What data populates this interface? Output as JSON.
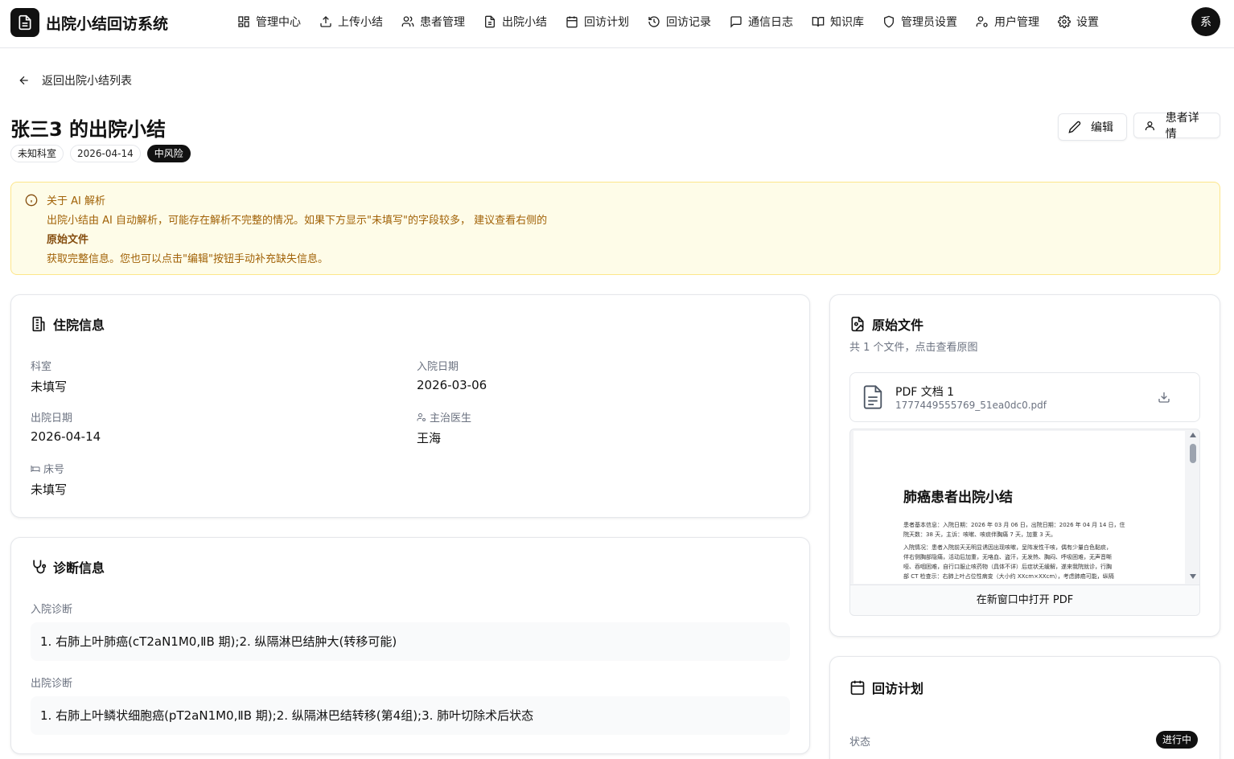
{
  "app": {
    "title": "出院小结回访系统",
    "avatar_text": "系"
  },
  "nav": {
    "items": [
      {
        "label": "管理中心",
        "icon": "dashboard-icon"
      },
      {
        "label": "上传小结",
        "icon": "upload-icon"
      },
      {
        "label": "患者管理",
        "icon": "users-icon"
      },
      {
        "label": "出院小结",
        "icon": "file-icon"
      },
      {
        "label": "回访计划",
        "icon": "calendar-icon"
      },
      {
        "label": "回访记录",
        "icon": "history-icon"
      },
      {
        "label": "通信日志",
        "icon": "message-icon"
      },
      {
        "label": "知识库",
        "icon": "book-icon"
      },
      {
        "label": "管理员设置",
        "icon": "shield-icon"
      },
      {
        "label": "用户管理",
        "icon": "user-cog-icon"
      },
      {
        "label": "设置",
        "icon": "gear-icon"
      }
    ]
  },
  "back_link": "返回出院小结列表",
  "header": {
    "title": "张三3 的出院小结",
    "tags": {
      "department": "未知科室",
      "date": "2026-04-14",
      "risk": "中风险"
    },
    "edit_label": "编辑",
    "patient_detail_label": "患者详情"
  },
  "alert": {
    "title": "关于 AI 解析",
    "line1": "出院小结由 AI 自动解析，可能存在解析不完整的情况。如果下方显示\"未填写\"的字段较多， 建议查看右侧的",
    "emphasis": "原始文件",
    "line2": "获取完整信息。您也可以点击\"编辑\"按钮手动补充缺失信息。"
  },
  "hospital_info": {
    "title": "住院信息",
    "department_label": "科室",
    "department_value": "未填写",
    "admission_label": "入院日期",
    "admission_value": "2026-03-06",
    "discharge_label": "出院日期",
    "discharge_value": "2026-04-14",
    "doctor_label": "主治医生",
    "doctor_value": "王海",
    "bed_label": "床号",
    "bed_value": "未填写"
  },
  "diagnosis": {
    "title": "诊断信息",
    "admission_label": "入院诊断",
    "admission_value": "1. 右肺上叶肺癌(cT2aN1M0,ⅡB 期);2. 纵隔淋巴结肿大(转移可能)",
    "discharge_label": "出院诊断",
    "discharge_value": "1. 右肺上叶鳞状细胞癌(pT2aN1M0,ⅡB 期);2. 纵隔淋巴结转移(第4组);3. 肺叶切除术后状态"
  },
  "original_file": {
    "title": "原始文件",
    "subtitle": "共 1 个文件，点击查看原图",
    "file_name": "PDF 文档 1",
    "file_id": "1777449555769_51ea0dc0.pdf",
    "preview": {
      "heading": "肺癌患者出院小结",
      "lines": [
        "患者基本信息：入院日期：2026 年 03 月 06 日，出院日期：2026 年 04 月 14 日，住",
        "院天数：38 天，主诉：咳嗽、咳痰伴胸痛 7 天，加重 3 天。",
        "入院情况：患者入院前天无明显诱因出现咳嗽，呈阵发性干咳，偶有少量白色黏痰，",
        "伴右侧胸部隐痛，活动后加重，无咯血、盗汗，无发热、胸闷、呼吸困难，无声音嘶",
        "哑、吞咽困难，自行口服止咳药物（具体不详）后症状无缓解，遂来我院就诊，行胸",
        "部 CT 检查示：右肺上叶占位性病变（大小约 XXcm×XXcm），考虑肺癌可能，纵隔"
      ]
    },
    "open_label": "在新窗口中打开 PDF"
  },
  "followup_plan": {
    "title": "回访计划",
    "status_label": "状态",
    "status_value": "进行中"
  }
}
